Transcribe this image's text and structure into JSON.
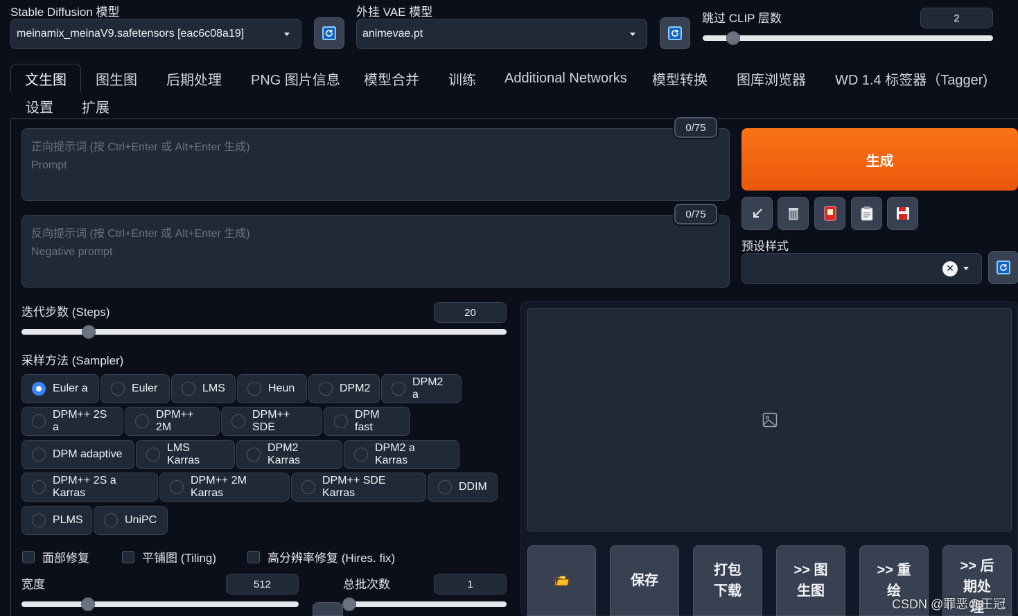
{
  "top": {
    "sd_model_label": "Stable Diffusion 模型",
    "sd_model_value": "meinamix_meinaV9.safetensors [eac6c08a19]",
    "vae_label": "外挂 VAE 模型",
    "vae_value": "animevae.pt",
    "clip_label": "跳过 CLIP 层数",
    "clip_value": "2"
  },
  "tabs": [
    {
      "label": "文生图"
    },
    {
      "label": "图生图"
    },
    {
      "label": "后期处理"
    },
    {
      "label": "PNG 图片信息"
    },
    {
      "label": "模型合并"
    },
    {
      "label": "训练"
    },
    {
      "label": "Additional Networks"
    },
    {
      "label": "模型转换"
    },
    {
      "label": "图库浏览器"
    },
    {
      "label": "WD 1.4 标签器（Tagger)"
    },
    {
      "label": "设置"
    },
    {
      "label": "扩展"
    }
  ],
  "prompt": {
    "placeholder_line1": "正向提示词 (按 Ctrl+Enter 或 Alt+Enter 生成)",
    "placeholder_line2": "Prompt",
    "token_count": "0/75"
  },
  "negative_prompt": {
    "placeholder_line1": "反向提示词 (按 Ctrl+Enter 或 Alt+Enter 生成)",
    "placeholder_line2": "Negative prompt",
    "token_count": "0/75"
  },
  "generate": {
    "label": "生成",
    "tools": [
      "arrow-icon",
      "trash-icon",
      "card-icon",
      "clipboard-icon",
      "save-icon"
    ],
    "styles_label": "预设样式"
  },
  "steps": {
    "label": "迭代步数 (Steps)",
    "value": "20",
    "fraction": 0.13
  },
  "sampler": {
    "label": "采样方法 (Sampler)",
    "selected": "Euler a",
    "options": [
      "Euler a",
      "Euler",
      "LMS",
      "Heun",
      "DPM2",
      "DPM2 a",
      "DPM++ 2S a",
      "DPM++ 2M",
      "DPM++ SDE",
      "DPM fast",
      "DPM adaptive",
      "LMS Karras",
      "DPM2 Karras",
      "DPM2 a Karras",
      "DPM++ 2S a Karras",
      "DPM++ 2M Karras",
      "DPM++ SDE Karras",
      "DDIM",
      "PLMS",
      "UniPC"
    ]
  },
  "checkboxes": {
    "face": "面部修复",
    "tiling": "平铺图 (Tiling)",
    "hires": "高分辨率修复 (Hires. fix)"
  },
  "width": {
    "label": "宽度",
    "value": "512"
  },
  "batch_count": {
    "label": "总批次数",
    "value": "1"
  },
  "actions": {
    "save": "保存",
    "zip_line1": "打包",
    "zip_line2": "下载",
    "img2img_line1": ">> 图",
    "img2img_line2": "生图",
    "inpaint_line1": ">> 重",
    "inpaint_line2": "绘",
    "extras_line1": ">> 后",
    "extras_line2": "期处",
    "extras_line3": "理"
  },
  "watermark": "CSDN @罪恶の王冠"
}
